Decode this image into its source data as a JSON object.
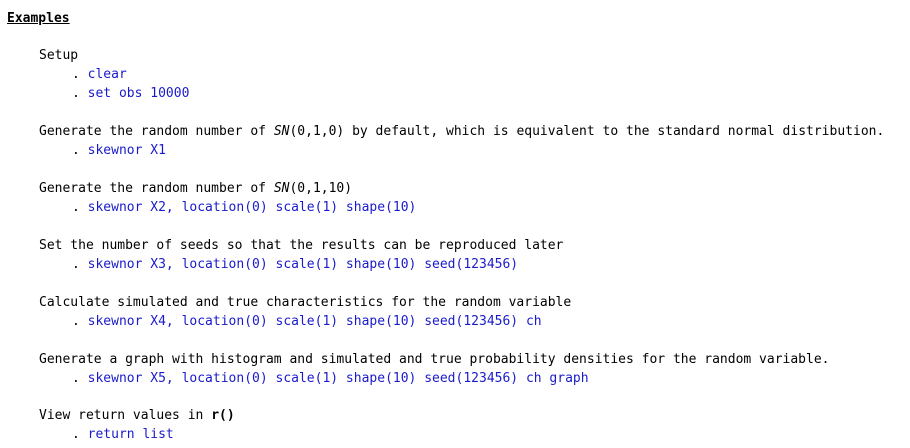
{
  "heading": "Examples",
  "sections": [
    {
      "desc": "Setup",
      "commands": [
        "clear",
        "set obs 10000"
      ]
    },
    {
      "desc_pre": "Generate the random number of ",
      "desc_ital": "SN",
      "desc_post": "(0,1,0) by default, which is equivalent to the standard normal distribution.",
      "commands": [
        "skewnor X1"
      ]
    },
    {
      "desc_pre": "Generate the random number of ",
      "desc_ital": "SN",
      "desc_post": "(0,1,10)",
      "commands": [
        "skewnor X2, location(0) scale(1) shape(10)"
      ]
    },
    {
      "desc": "Set the number of seeds so that the results can be reproduced later",
      "commands": [
        "skewnor X3, location(0) scale(1) shape(10) seed(123456)"
      ]
    },
    {
      "desc": "Calculate simulated and true characteristics for the random variable",
      "commands": [
        "skewnor X4, location(0) scale(1) shape(10) seed(123456) ch"
      ]
    },
    {
      "desc": "Generate a graph with histogram and simulated and true probability densities for the random variable.",
      "commands": [
        "skewnor X5, location(0) scale(1) shape(10) seed(123456) ch graph"
      ]
    },
    {
      "desc_pre": "View return values in ",
      "desc_bold": "r()",
      "commands": [
        "return list"
      ]
    }
  ],
  "dot": "."
}
